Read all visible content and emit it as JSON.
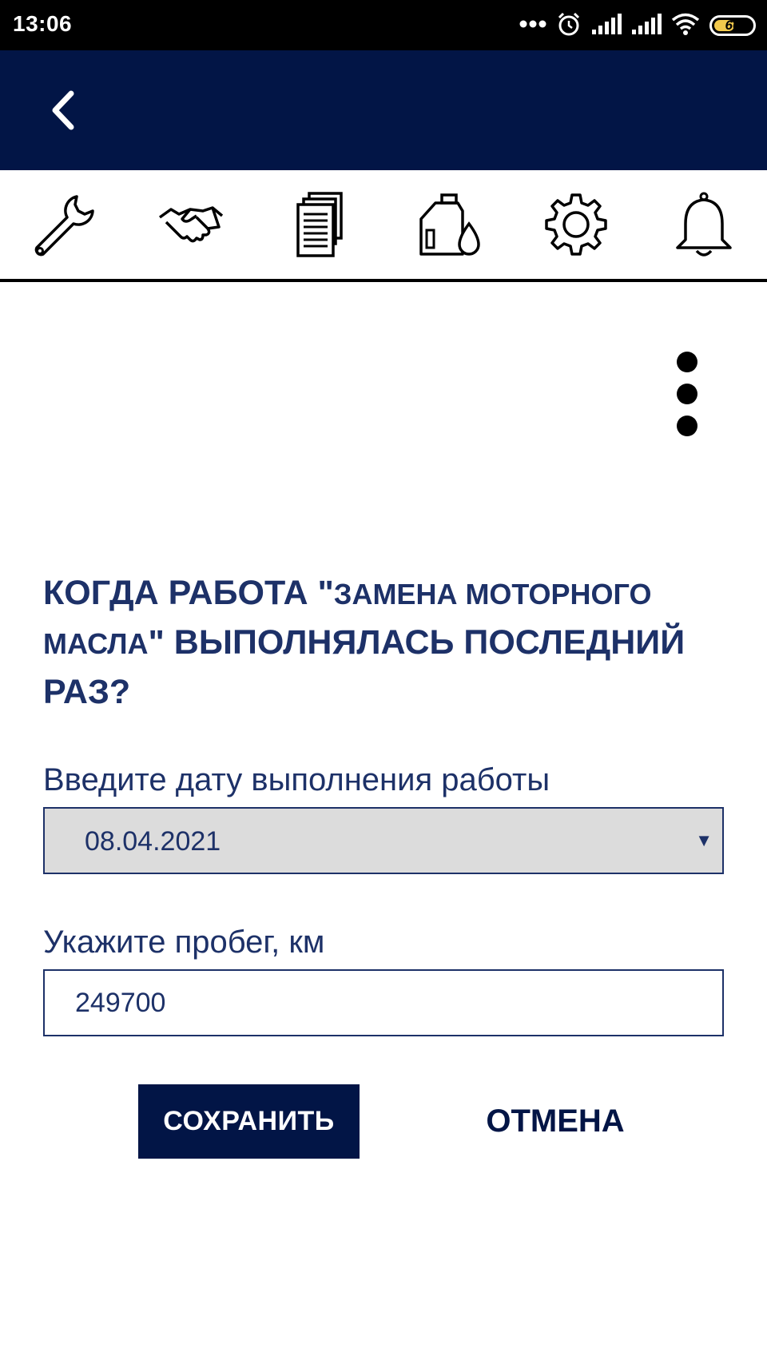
{
  "status_bar": {
    "time": "13:06",
    "battery_level": "60",
    "battery_fraction": 0.6,
    "icons": [
      "more-notifications-icon",
      "alarm-icon",
      "signal-icon",
      "signal-icon",
      "wifi-icon",
      "battery-icon"
    ]
  },
  "app_bar": {
    "background": "#021546",
    "back_icon": "back-arrow-icon"
  },
  "toolbar": {
    "items": [
      {
        "name": "tool-wrench",
        "icon": "wrench-icon"
      },
      {
        "name": "tool-handshake",
        "icon": "handshake-icon"
      },
      {
        "name": "tool-documents",
        "icon": "documents-icon"
      },
      {
        "name": "tool-oil",
        "icon": "oil-canister-icon"
      },
      {
        "name": "tool-settings",
        "icon": "gear-icon"
      },
      {
        "name": "tool-notifications",
        "icon": "bell-icon"
      }
    ]
  },
  "menu": {
    "icon": "more-vertical-icon"
  },
  "question": {
    "part1": "КОГДА РАБОТА \"",
    "job_name": "ЗАМЕНА МОТОРНОГО МАСЛА",
    "part2": "\" ВЫПОЛНЯЛАСЬ ПОСЛЕДНИЙ РАЗ?"
  },
  "form": {
    "date_label": "Введите дату выполнения работы",
    "date_value": "08.04.2021",
    "mileage_label": "Укажите пробег, км",
    "mileage_value": "249700"
  },
  "actions": {
    "save_label": "СОХРАНИТЬ",
    "cancel_label": "ОТМЕНА"
  },
  "colors": {
    "primary": "#021546",
    "text": "#1d3168",
    "select_background": "#dcdcdc"
  }
}
